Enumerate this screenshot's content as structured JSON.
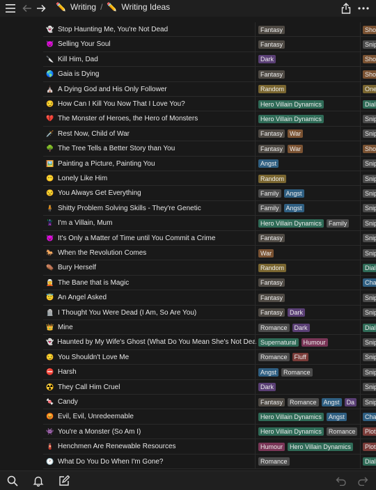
{
  "topbar": {
    "icons": [
      "menu-icon",
      "back-arrow-icon",
      "forward-arrow-icon",
      "share-icon",
      "more-icon"
    ],
    "breadcrumb": [
      {
        "emoji": "✏️",
        "label": "Writing"
      },
      {
        "emoji": "✏️",
        "label": "Writing Ideas"
      }
    ],
    "separator": "/"
  },
  "colors": {
    "Fantasy": "#4f4a44",
    "Dark": "#5a3f75",
    "Random": "#7a6630",
    "Hero Villain Dynamics": "#2f6b57",
    "War": "#7a5232",
    "Angst": "#2f5f82",
    "Family": "#4b4b4b",
    "Romance": "#4b4b4b",
    "Supernatural": "#2f6b57",
    "Humour": "#7a3657",
    "Fluff": "#7a3c39",
    "Sho": "#7a5232",
    "Snip": "#4b4b4b",
    "One": "#7a6630",
    "Dial": "#2f6b57",
    "Cha": "#2f5f82",
    "Plot": "#7a3c39"
  },
  "rows": [
    {
      "emoji": "👻",
      "name": "Stop Haunting Me, You're Not Dead",
      "tags": [
        "Fantasy"
      ],
      "type": "Sho"
    },
    {
      "emoji": "😈",
      "name": "Selling Your Soul",
      "tags": [
        "Fantasy"
      ],
      "type": "Snip"
    },
    {
      "emoji": "🔪",
      "name": "Kill Him, Dad",
      "tags": [
        "Dark"
      ],
      "type": "Sho"
    },
    {
      "emoji": "🌎",
      "name": "Gaia is Dying",
      "tags": [
        "Fantasy"
      ],
      "type": "Sho"
    },
    {
      "emoji": "⛪",
      "name": "A Dying God and His Only Follower",
      "tags": [
        "Random"
      ],
      "type": "One"
    },
    {
      "emoji": "😏",
      "name": "How Can I Kill You Now That I Love You?",
      "tags": [
        "Hero Villain Dynamics"
      ],
      "type": "Dial"
    },
    {
      "emoji": "💔",
      "name": "The Monster of Heroes, the Hero of Monsters",
      "tags": [
        "Hero Villain Dynamics"
      ],
      "type": "Snip"
    },
    {
      "emoji": "🗡️",
      "name": "Rest Now, Child of War",
      "tags": [
        "Fantasy",
        "War"
      ],
      "type": "Snip"
    },
    {
      "emoji": "🌳",
      "name": "The Tree Tells a Better Story than You",
      "tags": [
        "Fantasy",
        "War"
      ],
      "type": "Sho"
    },
    {
      "emoji": "🖼️",
      "name": "Painting a Picture, Painting You",
      "tags": [
        "Angst"
      ],
      "type": "Snip"
    },
    {
      "emoji": "😶",
      "name": "Lonely Like Him",
      "tags": [
        "Random"
      ],
      "type": "Snip"
    },
    {
      "emoji": "😒",
      "name": "You Always Get Everything",
      "tags": [
        "Family",
        "Angst"
      ],
      "type": "Snip"
    },
    {
      "emoji": "🧍",
      "name": "Shitty Problem Solving Skills - They're Genetic",
      "tags": [
        "Family",
        "Angst"
      ],
      "type": "Snip"
    },
    {
      "emoji": "🦹",
      "name": "I'm a Villain, Mum",
      "tags": [
        "Hero Villain Dynamics",
        "Family"
      ],
      "type": "Snip"
    },
    {
      "emoji": "😈",
      "name": "It's Only a Matter of Time until You Commit a Crime",
      "tags": [
        "Fantasy"
      ],
      "type": "Snip"
    },
    {
      "emoji": "🐎",
      "name": "When the Revolution Comes",
      "tags": [
        "War"
      ],
      "type": "Snip"
    },
    {
      "emoji": "⚰️",
      "name": "Bury Herself",
      "tags": [
        "Random"
      ],
      "type": "Dial"
    },
    {
      "emoji": "🧝",
      "name": "The Bane that is Magic",
      "tags": [
        "Fantasy"
      ],
      "type": "Cha"
    },
    {
      "emoji": "😇",
      "name": "An Angel Asked",
      "tags": [
        "Fantasy"
      ],
      "type": "Snip"
    },
    {
      "emoji": "🪦",
      "name": "I Thought You Were Dead (I Am, So Are You)",
      "tags": [
        "Fantasy",
        "Dark"
      ],
      "type": "Snip"
    },
    {
      "emoji": "👑",
      "name": "Mine",
      "tags": [
        "Romance",
        "Dark"
      ],
      "type": "Dial"
    },
    {
      "emoji": "👻",
      "name": "Haunted by My Wife's Ghost (What Do You Mean She's Not Dead?",
      "tags": [
        "Supernatural",
        "Humour"
      ],
      "type": "Snip"
    },
    {
      "emoji": "😏",
      "name": "You Shouldn't Love Me",
      "tags": [
        "Romance",
        "Fluff"
      ],
      "type": "Snip"
    },
    {
      "emoji": "⛔",
      "name": "Harsh",
      "tags": [
        "Angst",
        "Romance"
      ],
      "type": "Snip"
    },
    {
      "emoji": "☢️",
      "name": "They Call Him Cruel",
      "tags": [
        "Dark"
      ],
      "type": "Snip"
    },
    {
      "emoji": "🍬",
      "name": "Candy",
      "tags": [
        "Fantasy",
        "Romance",
        "Angst",
        "Da"
      ],
      "type": "Snip"
    },
    {
      "emoji": "😡",
      "name": "Evil, Evil, Unredeemable",
      "tags": [
        "Hero Villain Dynamics",
        "Angst"
      ],
      "type": "Cha"
    },
    {
      "emoji": "👾",
      "name": "You're a Monster (So Am I)",
      "tags": [
        "Hero Villain Dynamics",
        "Romance"
      ],
      "type": "Plot"
    },
    {
      "emoji": "🧯",
      "name": "Henchmen Are Renewable Resources",
      "tags": [
        "Humour",
        "Hero Villain Dynamics"
      ],
      "type": "Plot"
    },
    {
      "emoji": "🕐",
      "name": "What Do You Do When I'm Gone?",
      "tags": [
        "Romance"
      ],
      "type": "Dial"
    }
  ],
  "bottombar": {
    "icons": [
      "search-icon",
      "bell-icon",
      "compose-icon",
      "undo-icon",
      "redo-icon"
    ]
  }
}
